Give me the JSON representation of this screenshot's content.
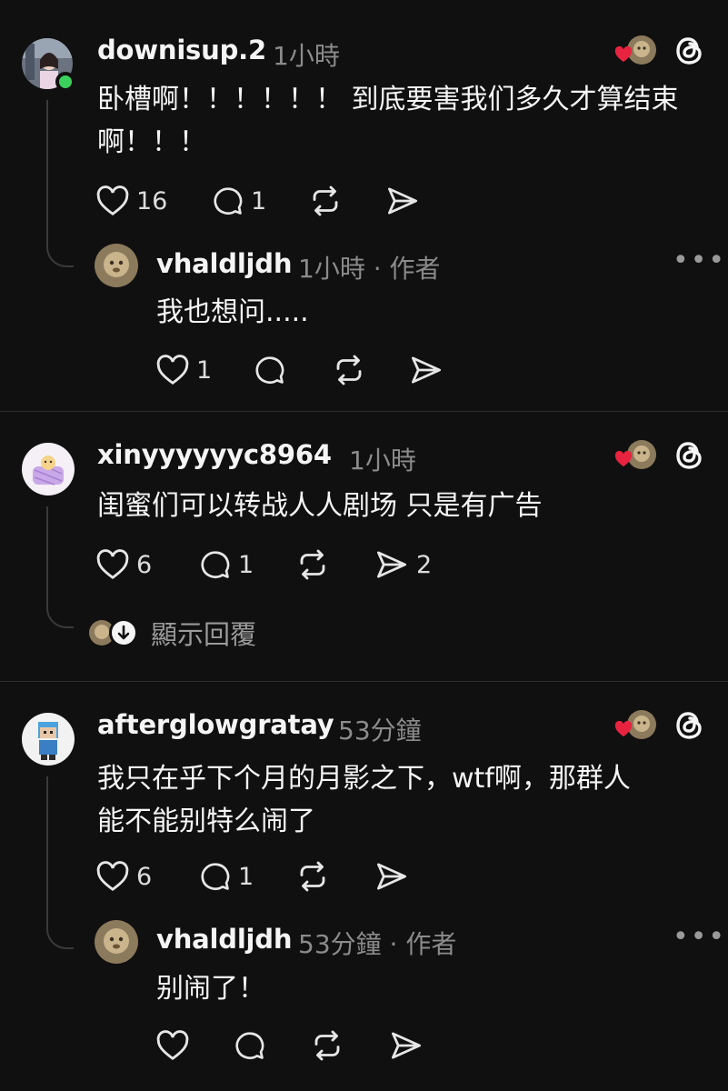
{
  "threads": [
    {
      "username": "downisup.2",
      "time": "1小時",
      "text": "卧槽啊！！！！！！ 到底要害我们多久才算结束\n啊！！！",
      "likes": "16",
      "replies": "1",
      "reply": {
        "username": "vhaldljdh",
        "meta": "1小時 · 作者",
        "text": "我也想问.....",
        "likes": "1"
      }
    },
    {
      "username": "xinyyyyyyc8964",
      "time": "1小時",
      "text": "闺蜜们可以转战人人剧场 只是有广告",
      "likes": "6",
      "replies": "1",
      "shares": "2",
      "show_replies_label": "顯示回覆"
    },
    {
      "username": "afterglowgratay",
      "time": "53分鐘",
      "text": "我只在乎下个月的月影之下，wtf啊，那群人\n能不能别特么闹了",
      "likes": "6",
      "replies": "1",
      "reply": {
        "username": "vhaldljdh",
        "meta": "53分鐘 · 作者",
        "text": "别闹了！"
      }
    }
  ],
  "more_label": "•••",
  "icons": {
    "like": "heart-outline-icon",
    "reply": "comment-bubble-icon",
    "repost": "repost-arrows-icon",
    "share": "send-paper-plane-icon",
    "app": "threads-logo-icon"
  },
  "colors": {
    "background": "#101010",
    "heart": "#e8233f",
    "online": "#3ad15c",
    "muted": "#8b8b8b"
  }
}
